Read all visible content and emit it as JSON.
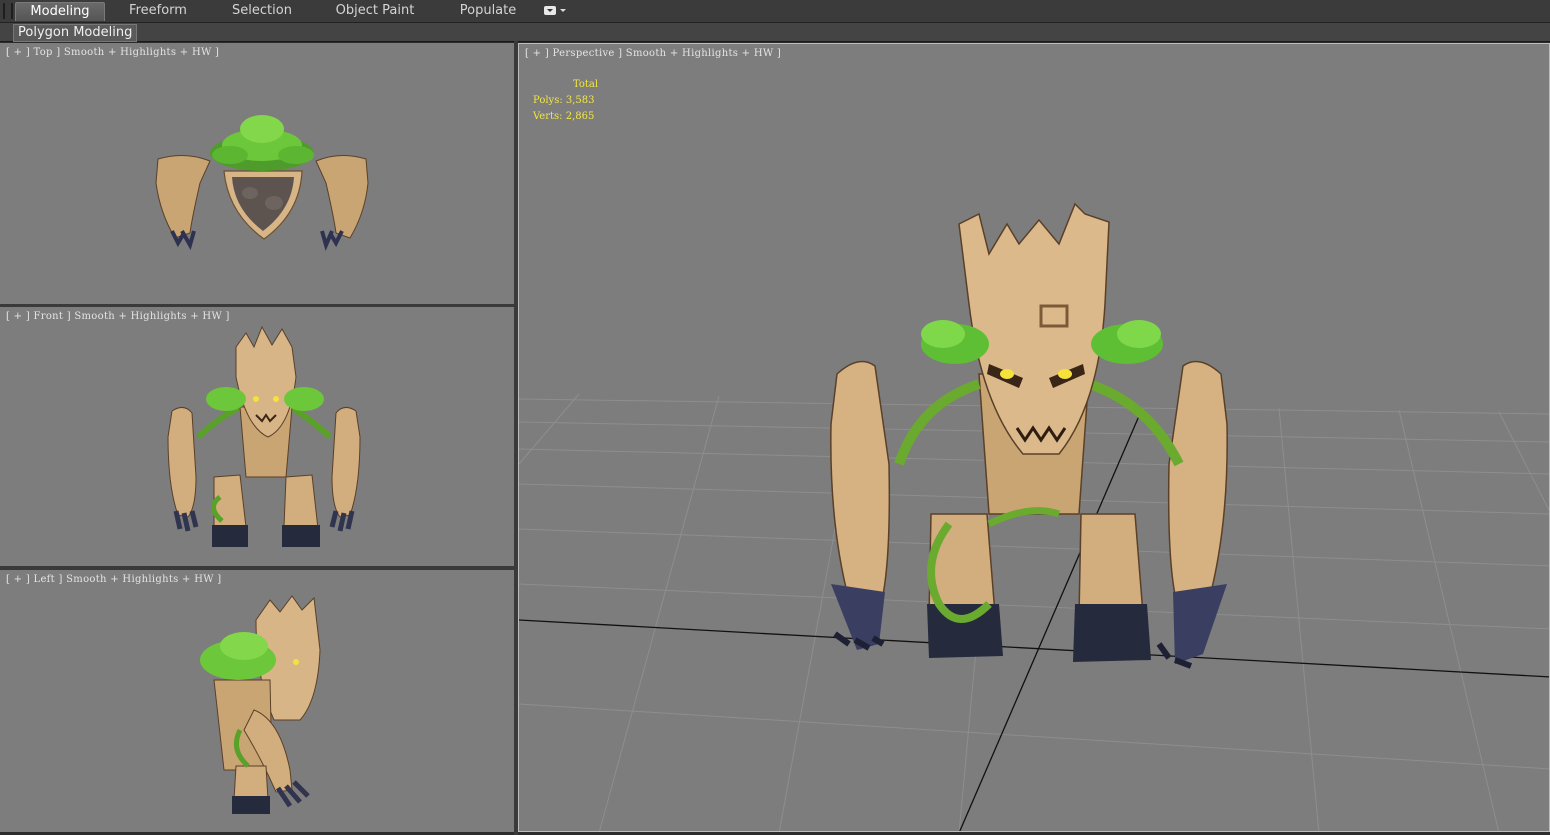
{
  "ribbon": {
    "tabs": [
      "Modeling",
      "Freeform",
      "Selection",
      "Object Paint",
      "Populate"
    ],
    "active_tab": "Modeling",
    "panel_label": "Polygon Modeling"
  },
  "viewports": {
    "top": {
      "label": "[ + ] Top ] Smooth + Highlights + HW ]"
    },
    "front": {
      "label": "[ + ] Front ] Smooth + Highlights + HW ]"
    },
    "left": {
      "label": "[ + ] Left ] Smooth + Highlights + HW ]"
    },
    "perspective": {
      "label": "[ + ] Perspective ] Smooth + Highlights + HW ]",
      "stats": {
        "header": "Total",
        "polys": "Polys: 3,583",
        "verts": "Verts: 2,865"
      }
    }
  },
  "colors": {
    "viewport_bg": "#7d7d7d",
    "stats_text": "#f2e642",
    "wood": "#d8b587",
    "leaf": "#6cc73a",
    "claw": "#30344f"
  }
}
